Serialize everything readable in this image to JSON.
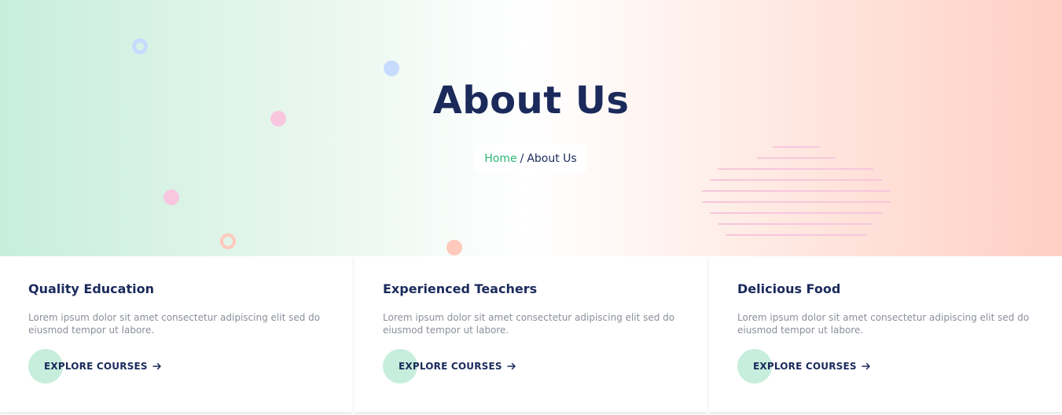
{
  "hero": {
    "title": "About Us",
    "breadcrumb": {
      "home": "Home",
      "separator": "/",
      "current": "About Us"
    }
  },
  "colors": {
    "navy": "#1b2a5b",
    "green": "#2bb673",
    "mint": "#c7eedc",
    "peach": "#ffcfc4",
    "pink": "#f9c6e0",
    "blue": "#c7dbff"
  },
  "cards": [
    {
      "title": "Quality Education",
      "text": "Lorem ipsum dolor sit amet consectetur adipiscing elit sed do eiusmod tempor ut labore.",
      "cta": "EXPLORE COURSES",
      "cta_icon": "arrow-right-icon"
    },
    {
      "title": "Experienced Teachers",
      "text": "Lorem ipsum dolor sit amet consectetur adipiscing elit sed do eiusmod tempor ut labore.",
      "cta": "EXPLORE COURSES",
      "cta_icon": "arrow-right-icon"
    },
    {
      "title": "Delicious Food",
      "text": "Lorem ipsum dolor sit amet consectetur adipiscing elit sed do eiusmod tempor ut labore.",
      "cta": "EXPLORE COURSES",
      "cta_icon": "arrow-right-icon"
    }
  ]
}
